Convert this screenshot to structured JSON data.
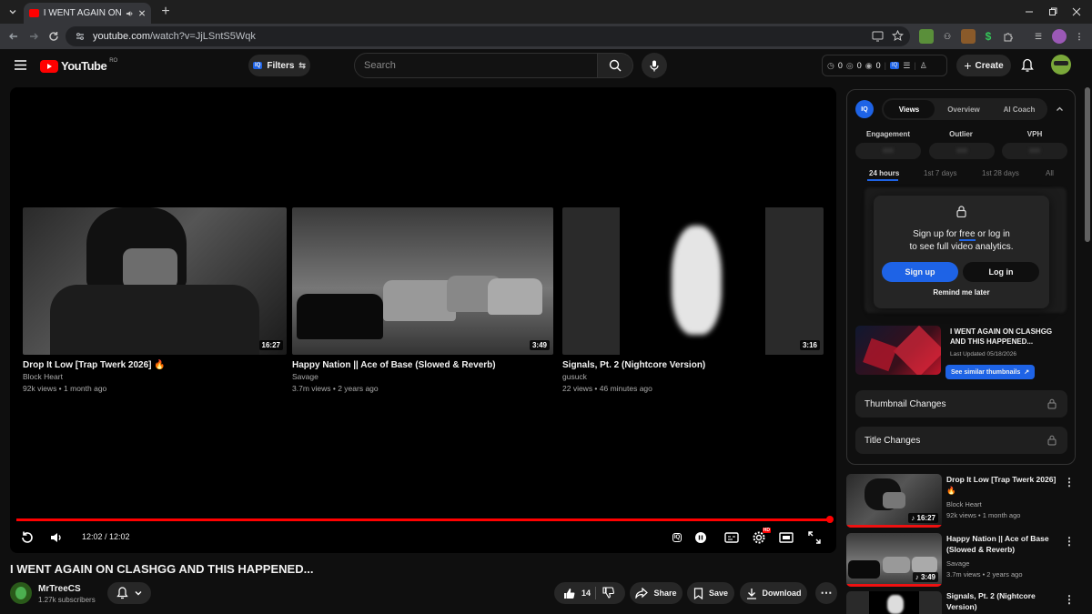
{
  "browser": {
    "tab_title": "I WENT AGAIN ON CLASHG",
    "url_domain": "youtube.com",
    "url_path": "/watch?v=JjLSntS5Wqk",
    "new_tab": "+"
  },
  "youtube": {
    "logo_text": "YouTube",
    "region": "RO",
    "filters_label": "Filters",
    "search_placeholder": "Search",
    "stats": [
      "0",
      "0",
      "0"
    ],
    "create_label": "Create"
  },
  "player": {
    "end_cards": [
      {
        "title": "Drop It Low [Trap Twerk 2026]",
        "channel": "Block Heart",
        "meta": "92k views • 1 month ago",
        "duration": "16:27"
      },
      {
        "title": "Happy Nation || Ace of Base (Slowed & Reverb)",
        "channel": "Savage",
        "meta": "3.7m views • 2 years ago",
        "duration": "3:49"
      },
      {
        "title": "Signals, Pt. 2 (Nightcore Version)",
        "channel": "gusuck",
        "meta": "22 views • 46 minutes ago",
        "duration": "3:16"
      }
    ],
    "time": "12:02 / 12:02",
    "progress": 1.0,
    "hd_badge": "HD",
    "accent": "#ff0000"
  },
  "video": {
    "title": "I WENT AGAIN ON CLASHGG AND THIS HAPPENED...",
    "channel": "MrTreeCS",
    "subscribers": "1.27k subscribers",
    "likes": "14",
    "share_label": "Share",
    "save_label": "Save",
    "download_label": "Download"
  },
  "iq_panel": {
    "logo": "IQ",
    "tabs": [
      "Views",
      "Overview",
      "AI Coach"
    ],
    "active_tab": "Views",
    "metrics": [
      "Engagement",
      "Outlier",
      "VPH"
    ],
    "metric_values": [
      "000",
      "000",
      "000"
    ],
    "ranges": [
      "24 hours",
      "1st 7 days",
      "1st 28 days",
      "All"
    ],
    "active_range": "24 hours",
    "lock_line1_pre": "Sign up for ",
    "lock_line1_free": "free",
    "lock_line1_post": " or log in",
    "lock_line2": "to see full video analytics.",
    "signup_label": "Sign up",
    "login_label": "Log in",
    "remind_label": "Remind me later",
    "thumb_title": "I WENT AGAIN ON CLASHGG AND THIS HAPPENED...",
    "last_updated": "Last Updated 05/18/2026",
    "similar_label": "See similar thumbnails",
    "thumbnail_changes": "Thumbnail Changes",
    "title_changes": "Title Changes",
    "brand_color": "#1e63e6"
  },
  "recommendations": [
    {
      "title": "Drop It Low [Trap Twerk 2026]",
      "emoji": "🔥",
      "channel": "Block Heart",
      "meta": "92k views • 1 month ago",
      "duration": "16:27"
    },
    {
      "title": "Happy Nation || Ace of Base (Slowed & Reverb)",
      "channel": "Savage",
      "meta": "3.7m views • 2 years ago",
      "duration": "3:49"
    },
    {
      "title": "Signals, Pt. 2 (Nightcore Version)",
      "channel": "",
      "meta": "",
      "duration": ""
    }
  ]
}
